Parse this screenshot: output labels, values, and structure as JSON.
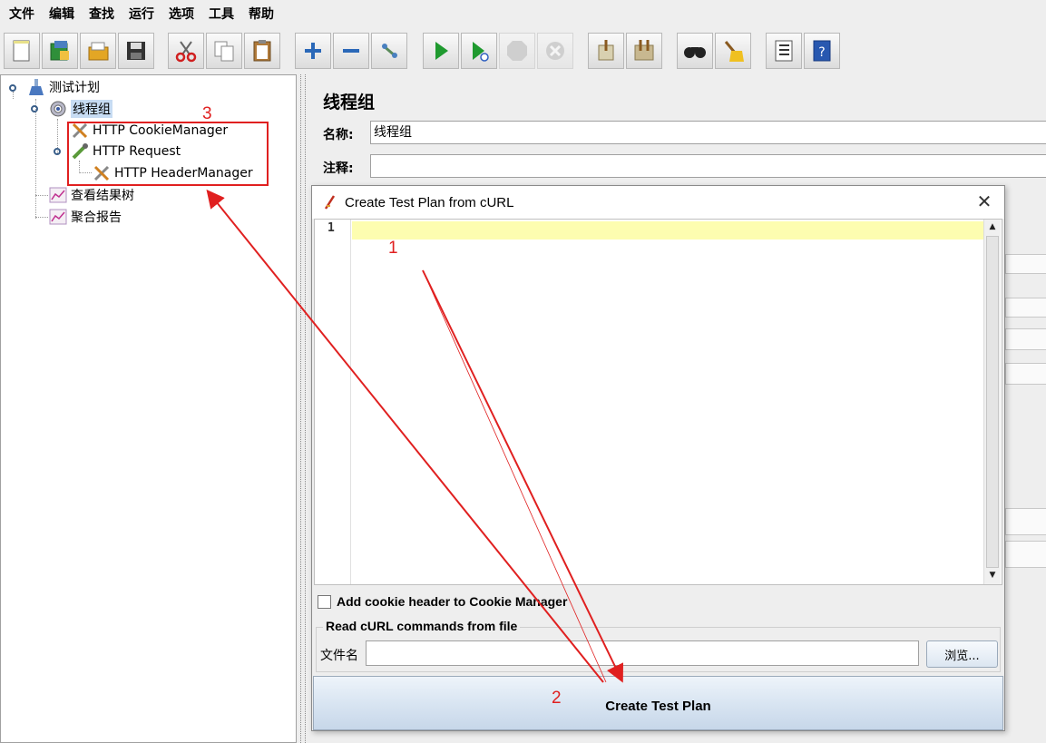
{
  "menu": [
    "文件",
    "编辑",
    "查找",
    "运行",
    "选项",
    "工具",
    "帮助"
  ],
  "toolbar": {
    "buttons": [
      "new-icon",
      "templates-icon",
      "open-icon",
      "save-icon",
      "cut-icon",
      "copy-icon",
      "paste-icon",
      "expand-icon",
      "collapse-icon",
      "toggle-icon",
      "start-icon",
      "start-no-pause-icon",
      "stop-icon",
      "shutdown-icon",
      "clear-icon",
      "clear-all-icon",
      "search-icon",
      "reset-search-icon",
      "function-helper-icon",
      "help-icon"
    ]
  },
  "tree": {
    "root": "测试计划",
    "thread_group": "线程组",
    "cookie_manager": "HTTP CookieManager",
    "http_request": "HTTP Request",
    "header_manager": "HTTP HeaderManager",
    "results_tree": "查看结果树",
    "aggregate_report": "聚合报告"
  },
  "panel": {
    "title": "线程组",
    "name_label": "名称:",
    "name_value": "线程组",
    "comment_label": "注释:",
    "comment_value": ""
  },
  "dialog": {
    "title": "Create Test Plan from cURL",
    "line_number": "1",
    "editor_content": "",
    "cookie_checkbox_label": "Add cookie header to Cookie Manager",
    "cookie_checked": false,
    "file_section_title": "Read cURL commands from file",
    "file_label": "文件名",
    "file_value": "",
    "browse_label": "浏览...",
    "create_label": "Create Test Plan"
  },
  "annotations": {
    "one": "1",
    "two": "2",
    "three": "3",
    "color": "#e02020"
  },
  "colors": {
    "selection": "#c7dcf3",
    "current_line": "#fdfdb0",
    "background": "#eeeeee"
  }
}
